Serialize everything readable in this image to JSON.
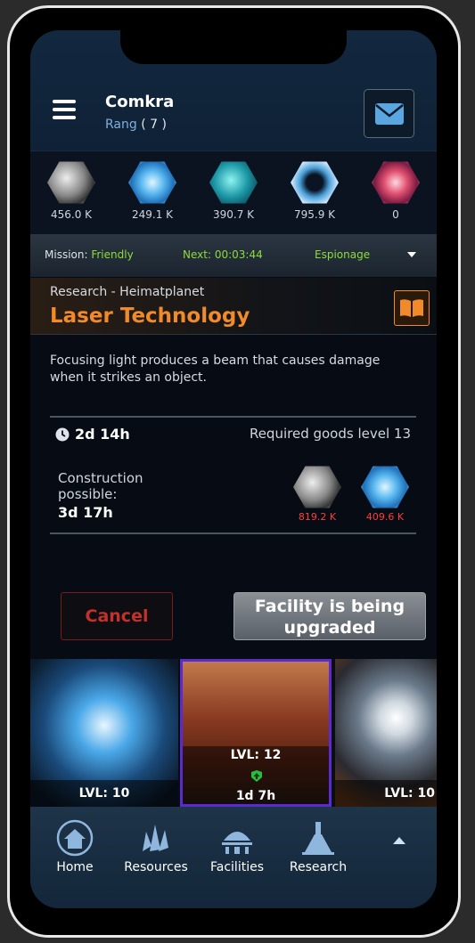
{
  "header": {
    "player_name": "Comkra",
    "rank_label": "Rang",
    "rank_value": "( 7 )"
  },
  "resources": [
    {
      "icon": "metal-ore-icon",
      "amount": "456.0 K"
    },
    {
      "icon": "crystal-icon",
      "amount": "249.1 K"
    },
    {
      "icon": "deuterium-icon",
      "amount": "390.7 K"
    },
    {
      "icon": "energy-orb-icon",
      "amount": "795.9 K"
    },
    {
      "icon": "dark-matter-icon",
      "amount": "0"
    }
  ],
  "mission_bar": {
    "mission_label": "Mission:",
    "mission_value": "Friendly",
    "next_label": "Next:",
    "next_value": "00:03:44",
    "type": "Espionage"
  },
  "research": {
    "subtitle": "Research - Heimatplanet",
    "title": "Laser Technology",
    "description": "Focusing light produces a beam that causes damage when it strikes an object.",
    "duration": "2d 14h",
    "required": "Required goods level 13",
    "construction_label": "Construction possible:",
    "construction_time": "3d 17h",
    "costs": [
      {
        "icon": "metal-ore-icon",
        "amount": "819.2 K"
      },
      {
        "icon": "crystal-icon",
        "amount": "409.6 K"
      }
    ]
  },
  "actions": {
    "cancel_label": "Cancel",
    "status_label": "Facility is being upgraded"
  },
  "cards": [
    {
      "level": "LVL: 10"
    },
    {
      "level": "LVL: 12",
      "time": "1d 7h"
    },
    {
      "level": "LVL: 10"
    }
  ],
  "nav": [
    {
      "label": "Home"
    },
    {
      "label": "Resources"
    },
    {
      "label": "Facilities"
    },
    {
      "label": "Research"
    }
  ],
  "colors": {
    "accent_orange": "#f08a2a",
    "mission_green": "#8ddc3b",
    "cost_red": "#ff3b3b",
    "active_card_border": "#5a2bd0"
  }
}
